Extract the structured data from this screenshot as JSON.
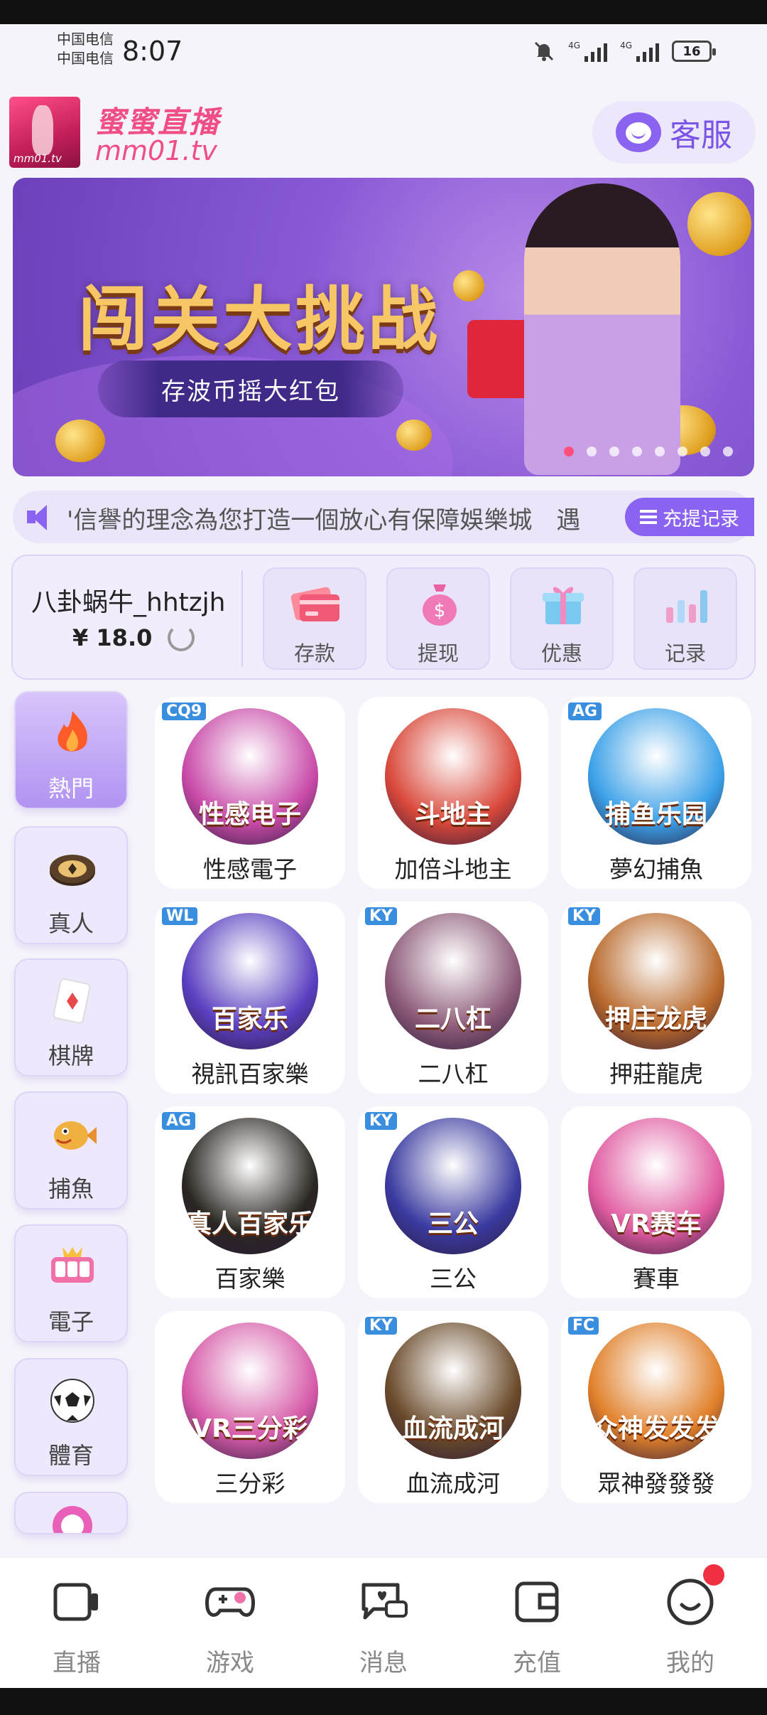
{
  "status_bar": {
    "carrier_1": "中国电信",
    "carrier_2": "中国电信",
    "time": "8:07",
    "network_1": "4G",
    "network_2": "4G",
    "battery": "16"
  },
  "header": {
    "logo_caption": "mm01.tv",
    "brand_name": "蜜蜜直播",
    "brand_domain": "mm01.tv",
    "service_label": "客服",
    "service_icon": "headset-icon"
  },
  "banner": {
    "title": "闯关大挑战",
    "subtitle": "存波币摇大红包",
    "slide_count": 8,
    "active_slide": 1
  },
  "marquee": {
    "text": "'信譽的理念為您打造一個放心有保障娛樂城　遇",
    "recharge_label": "充提记录"
  },
  "account": {
    "username": "八卦蜗牛_hhtzjh",
    "balance": "¥ 18.0",
    "actions": [
      {
        "label": "存款",
        "icon": "card-icon"
      },
      {
        "label": "提现",
        "icon": "money-bag-icon"
      },
      {
        "label": "优惠",
        "icon": "gift-icon"
      },
      {
        "label": "记录",
        "icon": "bar-chart-icon"
      }
    ]
  },
  "categories": [
    {
      "label": "熱門",
      "icon": "fire-icon",
      "active": true
    },
    {
      "label": "真人",
      "icon": "chip-icon",
      "active": false
    },
    {
      "label": "棋牌",
      "icon": "card-icon",
      "active": false
    },
    {
      "label": "捕魚",
      "icon": "fish-icon",
      "active": false
    },
    {
      "label": "電子",
      "icon": "slot-icon",
      "active": false
    },
    {
      "label": "體育",
      "icon": "soccer-ball-icon",
      "active": false
    }
  ],
  "games": [
    {
      "label": "性感電子",
      "tag": "CQ9",
      "inner": "性感电子",
      "color": "#c84aa8"
    },
    {
      "label": "加倍斗地主",
      "tag": "",
      "inner": "斗地主",
      "color": "#d9483a"
    },
    {
      "label": "夢幻捕魚",
      "tag": "AG",
      "inner": "捕鱼乐园",
      "color": "#3aa0e8"
    },
    {
      "label": "視訊百家樂",
      "tag": "WL",
      "inner": "百家乐",
      "color": "#5a3fc0"
    },
    {
      "label": "二八杠",
      "tag": "KY",
      "inner": "二八杠",
      "color": "#8c5a78"
    },
    {
      "label": "押莊龍虎",
      "tag": "KY",
      "inner": "押庄龙虎",
      "color": "#b8682a"
    },
    {
      "label": "百家樂",
      "tag": "AG",
      "inner": "真人百家乐",
      "color": "#2a2622"
    },
    {
      "label": "三公",
      "tag": "KY",
      "inner": "三公",
      "color": "#3a3aa0"
    },
    {
      "label": "賽車",
      "tag": "",
      "inner": "VR赛车",
      "color": "#e05aa0"
    },
    {
      "label": "三分彩",
      "tag": "",
      "inner": "VR三分彩",
      "color": "#d65aa8"
    },
    {
      "label": "血流成河",
      "tag": "KY",
      "inner": "血流成河",
      "color": "#6a4a2a"
    },
    {
      "label": "眾神發發發",
      "tag": "FC",
      "inner": "众神发发发",
      "color": "#e0802a"
    }
  ],
  "bottom_nav": [
    {
      "label": "直播",
      "icon": "live-camera-icon"
    },
    {
      "label": "游戏",
      "icon": "gamepad-icon"
    },
    {
      "label": "消息",
      "icon": "message-icon"
    },
    {
      "label": "充值",
      "icon": "wallet-icon"
    },
    {
      "label": "我的",
      "icon": "profile-smile-icon"
    }
  ]
}
